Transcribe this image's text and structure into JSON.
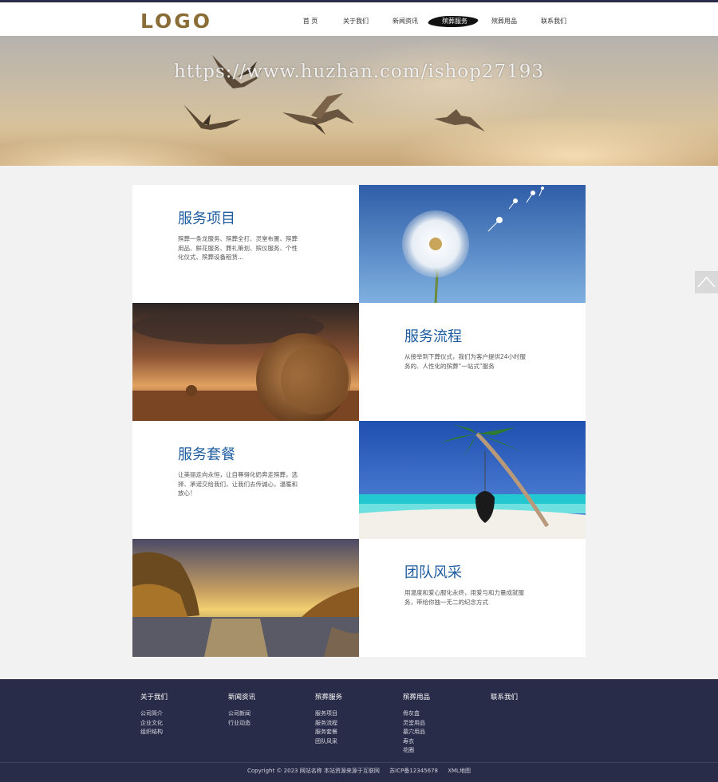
{
  "header": {
    "logo": "LOGO",
    "nav": [
      {
        "label": "首 页",
        "active": false
      },
      {
        "label": "关于我们",
        "active": false
      },
      {
        "label": "新闻资讯",
        "active": false
      },
      {
        "label": "殡葬服务",
        "active": true
      },
      {
        "label": "殡葬用品",
        "active": false
      },
      {
        "label": "联系我们",
        "active": false
      }
    ]
  },
  "banner": {
    "watermark": "https://www.huzhan.com/ishop27193"
  },
  "sections": [
    {
      "title": "服务项目",
      "desc": "殡葬一条龙服务、殡葬全打、灵堂布置、殡葬用品、鲜花服务、葬礼策划、殡仪服务、个性化仪式、殡葬设备租赁..."
    },
    {
      "title": "服务流程",
      "desc": "从接举到下葬仪式，我们为客户提供24小时服务的、人性化的殡葬“一站式”服务"
    },
    {
      "title": "服务套餐",
      "desc": "让美丽走向永恒，让自尊得化奶奔走殡葬，选择、承诺交给我们，让我们去传诚心，温暖和放心！"
    },
    {
      "title": "团队风采",
      "desc": "用温度和爱心服化永终，用爱与和力量成就服务，带给你独一无二的纪念方式"
    }
  ],
  "footer": {
    "columns": [
      {
        "title": "关于我们",
        "links": [
          "公司简介",
          "企业文化",
          "组织结构"
        ]
      },
      {
        "title": "新闻资讯",
        "links": [
          "公司新闻",
          "行业动态"
        ]
      },
      {
        "title": "殡葬服务",
        "links": [
          "服务项目",
          "服务流程",
          "服务套餐",
          "团队风采"
        ]
      },
      {
        "title": "殡葬用品",
        "links": [
          "骨灰盒",
          "灵堂用品",
          "墓穴用品",
          "寿衣",
          "花圈"
        ]
      },
      {
        "title": "联系我们",
        "links": []
      }
    ],
    "copyright": "Copyright © 2023 网站名称 本站资源来源于互联网",
    "icp": "苏ICP备12345678",
    "sitemap": "XML地图"
  },
  "colors": {
    "brand": "#8a6c37",
    "title_blue": "#1e5da0",
    "footer_bg": "#292c48",
    "page_bg": "#f2f2f2"
  },
  "icons": {
    "back_to_top": "chevron-up-icon"
  }
}
